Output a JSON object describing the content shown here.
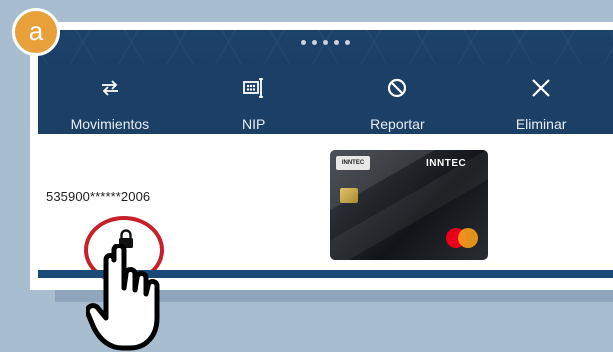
{
  "step_badge": "a",
  "pager": {
    "dots": 5
  },
  "actions": [
    {
      "label": "Movimientos",
      "icon": "swap-arrows-icon"
    },
    {
      "label": "NIP",
      "icon": "keypad-password-icon"
    },
    {
      "label": "Reportar",
      "icon": "block-icon"
    },
    {
      "label": "Eliminar",
      "icon": "close-icon"
    }
  ],
  "card": {
    "number": "535900******2006",
    "brand": "INNTEC",
    "lock_state": "locked",
    "network": "mastercard"
  },
  "colors": {
    "background": "#a9bdd0",
    "header": "#1c3f66",
    "badge": "#e8a13a",
    "highlight_ring": "#c8202b"
  }
}
